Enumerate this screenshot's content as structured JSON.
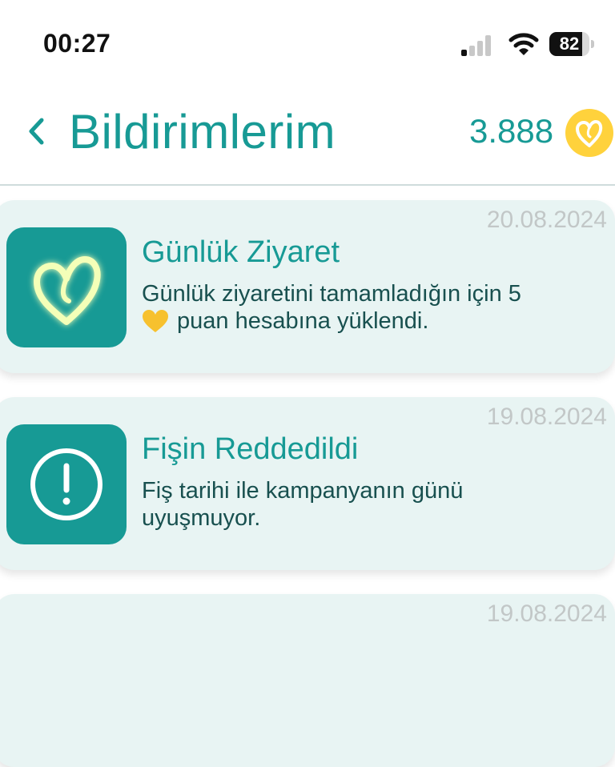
{
  "status_bar": {
    "time": "00:27",
    "battery": "82",
    "battery_level": 0.82
  },
  "header": {
    "title": "Bildirimlerim",
    "points": "3.888"
  },
  "notifications": [
    {
      "date": "20.08.2024",
      "title": "Günlük Ziyaret",
      "text_before": "Günlük ziyaretini tamamladığın için 5",
      "text_after": "puan hesabına yüklendi.",
      "icon": "glowing-heart-icon"
    },
    {
      "date": "19.08.2024",
      "title": "Fişin Reddedildi",
      "text": "Fiş tarihi ile kampanyanın günü uyuşmuyor.",
      "icon": "exclamation-circle-icon"
    },
    {
      "date": "19.08.2024"
    }
  ],
  "colors": {
    "accent": "#179a95",
    "card_background": "#e8f4f3",
    "coin": "#ffd23c",
    "body_text": "#18504f",
    "date_text": "#c2c7c7"
  }
}
